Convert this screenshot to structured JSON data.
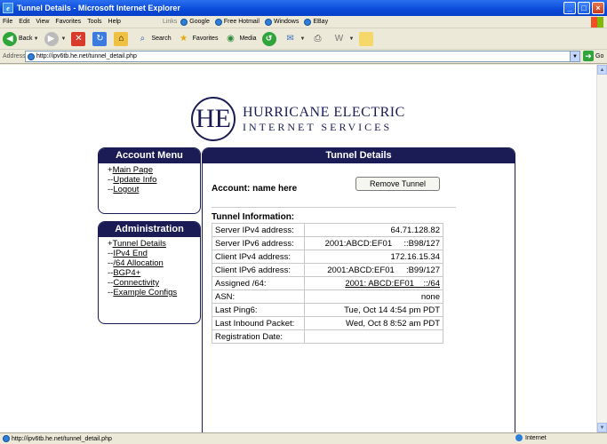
{
  "window": {
    "title": "Tunnel Details - Microsoft Internet Explorer"
  },
  "menu": [
    "File",
    "Edit",
    "View",
    "Favorites",
    "Tools",
    "Help"
  ],
  "links": {
    "label": "Links",
    "items": [
      "Google",
      "Free Hotmail",
      "Windows",
      "EBay"
    ]
  },
  "toolbar": {
    "back": "Back",
    "search": "Search",
    "favorites": "Favorites",
    "media": "Media"
  },
  "address": {
    "label": "Address",
    "url": "http://ipv6tb.he.net/tunnel_detail.php",
    "go": "Go"
  },
  "status": {
    "text": "http://ipv6tb.he.net/tunnel_detail.php",
    "zone": "Internet"
  },
  "logo": {
    "mark": "HE",
    "line1": "HURRICANE ELECTRIC",
    "line2": "INTERNET SERVICES"
  },
  "account_menu": {
    "title": "Account Menu",
    "items": [
      {
        "prefix": "+",
        "label": "Main Page"
      },
      {
        "prefix": "--",
        "label": "Update Info"
      },
      {
        "prefix": "--",
        "label": "Logout"
      }
    ]
  },
  "admin_menu": {
    "title": "Administration",
    "items": [
      {
        "prefix": "+",
        "label": "Tunnel Details"
      },
      {
        "prefix": "--",
        "label": "IPv4 End"
      },
      {
        "prefix": "--",
        "label": "/64 Allocation"
      },
      {
        "prefix": "--",
        "label": "BGP4+"
      },
      {
        "prefix": "--",
        "label": "Connectivity"
      },
      {
        "prefix": "--",
        "label": "Example Configs"
      }
    ]
  },
  "tunnel": {
    "title": "Tunnel Details",
    "account": "Account: name here",
    "remove_button": "Remove Tunnel",
    "info_label": "Tunnel Information:",
    "rows": [
      {
        "key": "Server IPv4 address:",
        "value": "64.71.128.82"
      },
      {
        "key": "Server IPv6 address:",
        "value": "2001:ABCD:EF01     ::B98/127"
      },
      {
        "key": "Client IPv4 address:",
        "value": "172.16.15.34"
      },
      {
        "key": "Client IPv6 address:",
        "value": "2001:ABCD:EF01     :B99/127"
      },
      {
        "key": "Assigned /64:",
        "value": "2001: ABCD:EF01    ::/64",
        "link": true
      },
      {
        "key": "ASN:",
        "value": "none"
      },
      {
        "key": "Last Ping6:",
        "value": "Tue, Oct 14 4:54 pm PDT"
      },
      {
        "key": "Last Inbound Packet:",
        "value": "Wed, Oct 8 8:52 am PDT"
      },
      {
        "key": "Registration Date:",
        "value": ""
      }
    ]
  }
}
